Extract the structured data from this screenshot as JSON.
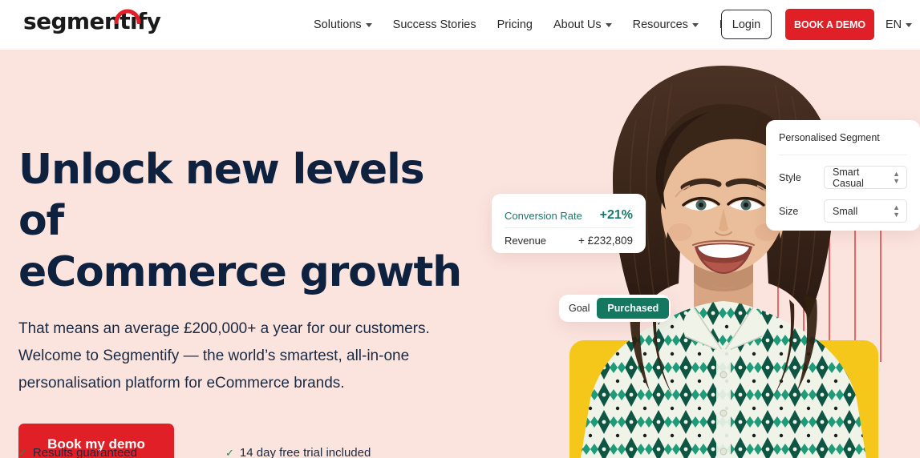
{
  "brand": {
    "logo_text": "segmentify",
    "accent_red": "#E01F27",
    "hero_bg": "#FCE4DE",
    "headline_navy": "#0E2240",
    "teal": "#17796B",
    "green": "#13785F",
    "yellow": "#F5C71A"
  },
  "header": {
    "nav": [
      {
        "label": "Solutions",
        "has_caret": true
      },
      {
        "label": "Success Stories",
        "has_caret": false
      },
      {
        "label": "Pricing",
        "has_caret": false
      },
      {
        "label": "About Us",
        "has_caret": true
      },
      {
        "label": "Resources",
        "has_caret": true
      },
      {
        "label": "Blog",
        "has_caret": false
      }
    ],
    "login_label": "Login",
    "demo_label": "BOOK A DEMO",
    "language": "EN"
  },
  "hero": {
    "headline_line1": "Unlock new levels of",
    "headline_line2": "eCommerce growth",
    "subcopy": "That means an average £200,000+ a year for our customers. Welcome to Segmentify — the world’s smartest, all-in-one personalisation platform for eCommerce brands.",
    "cta_label": "Book my demo",
    "trust": [
      {
        "check": "✓",
        "label": "Results guaranteed"
      },
      {
        "check": "✓",
        "label": "14 day free trial included"
      }
    ]
  },
  "metrics_card": {
    "rows": [
      {
        "label": "Conversion Rate",
        "value": "+21%"
      },
      {
        "label": "Revenue",
        "value": "+ £232,809"
      }
    ]
  },
  "segment_card": {
    "title": "Personalised Segment",
    "fields": [
      {
        "label": "Style",
        "value": "Smart Casual"
      },
      {
        "label": "Size",
        "value": "Small"
      }
    ]
  },
  "goal_card": {
    "label": "Goal",
    "status": "Purchased"
  }
}
